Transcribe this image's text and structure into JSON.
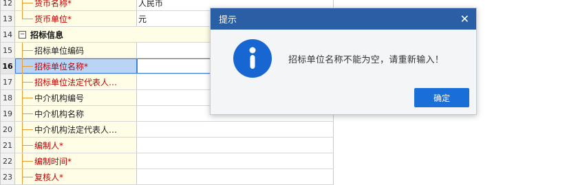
{
  "grid": {
    "rows": [
      {
        "num": "12",
        "label": "货币名称*",
        "required": true,
        "value": "人民币",
        "last": false
      },
      {
        "num": "13",
        "label": "货币单位*",
        "required": true,
        "value": "元",
        "last": true
      }
    ],
    "group": {
      "num": "14",
      "collapse_symbol": "−",
      "title": "招标信息"
    },
    "group_rows": [
      {
        "num": "15",
        "label": "招标单位编码",
        "required": false,
        "value": "",
        "last": false
      },
      {
        "num": "16",
        "label": "招标单位名称*",
        "required": true,
        "value": "",
        "last": false,
        "selected": true
      },
      {
        "num": "17",
        "label": "招标单位法定代表人…",
        "required": true,
        "value": "",
        "last": false
      },
      {
        "num": "18",
        "label": "中介机构编号",
        "required": false,
        "value": "",
        "last": false
      },
      {
        "num": "19",
        "label": "中介机构名称",
        "required": false,
        "value": "",
        "last": false
      },
      {
        "num": "20",
        "label": "中介机构法定代表人…",
        "required": false,
        "value": "",
        "last": false
      },
      {
        "num": "21",
        "label": "编制人*",
        "required": true,
        "value": "",
        "last": false
      },
      {
        "num": "22",
        "label": "编制时间*",
        "required": true,
        "value": "",
        "last": false
      },
      {
        "num": "23",
        "label": "复核人*",
        "required": true,
        "value": "",
        "last": false
      }
    ]
  },
  "dialog": {
    "title": "提示",
    "close_symbol": "✕",
    "icon": "info-icon",
    "message": "招标单位名称不能为空，请重新输入！",
    "ok_label": "确定"
  },
  "colors": {
    "accent": "#2a5fa6",
    "button": "#1a6ed8",
    "required_text": "#c00000",
    "label_bg": "#fffde6",
    "tree_line": "#e49a2c"
  }
}
